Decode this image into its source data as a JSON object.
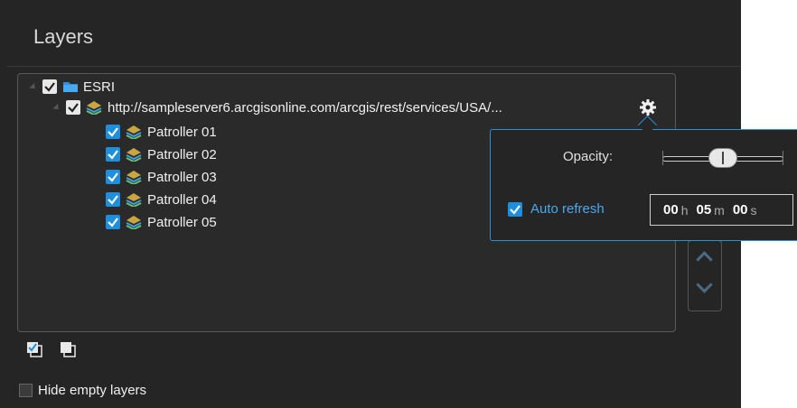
{
  "panel": {
    "title": "Layers"
  },
  "tree": {
    "root": {
      "label": "ESRI",
      "checked": true,
      "icon": "folder-icon"
    },
    "service": {
      "label": "http://sampleserver6.arcgisonline.com/arcgis/rest/services/USA/...",
      "checked": true,
      "icon": "map-layer-icon"
    },
    "layers": [
      {
        "label": "Patroller 01",
        "checked": true
      },
      {
        "label": "Patroller 02",
        "checked": true
      },
      {
        "label": "Patroller 03",
        "checked": true
      },
      {
        "label": "Patroller 04",
        "checked": true
      },
      {
        "label": "Patroller 05",
        "checked": true
      }
    ]
  },
  "popup": {
    "opacity_label": "Opacity:",
    "opacity_value": 0.5,
    "auto_refresh_label": "Auto refresh",
    "auto_refresh_checked": true,
    "hours": "00",
    "hours_unit": "h",
    "minutes": "05",
    "minutes_unit": "m",
    "seconds": "00",
    "seconds_unit": "s"
  },
  "footer": {
    "check_all_icon": "check-all-icon",
    "uncheck_all_icon": "uncheck-all-icon",
    "hide_empty_label": "Hide empty layers",
    "hide_empty_checked": false
  },
  "colors": {
    "background": "#252525",
    "accent": "#1e8fdc",
    "popup_border": "#2d8fd6",
    "link_text": "#4aa8ee"
  }
}
